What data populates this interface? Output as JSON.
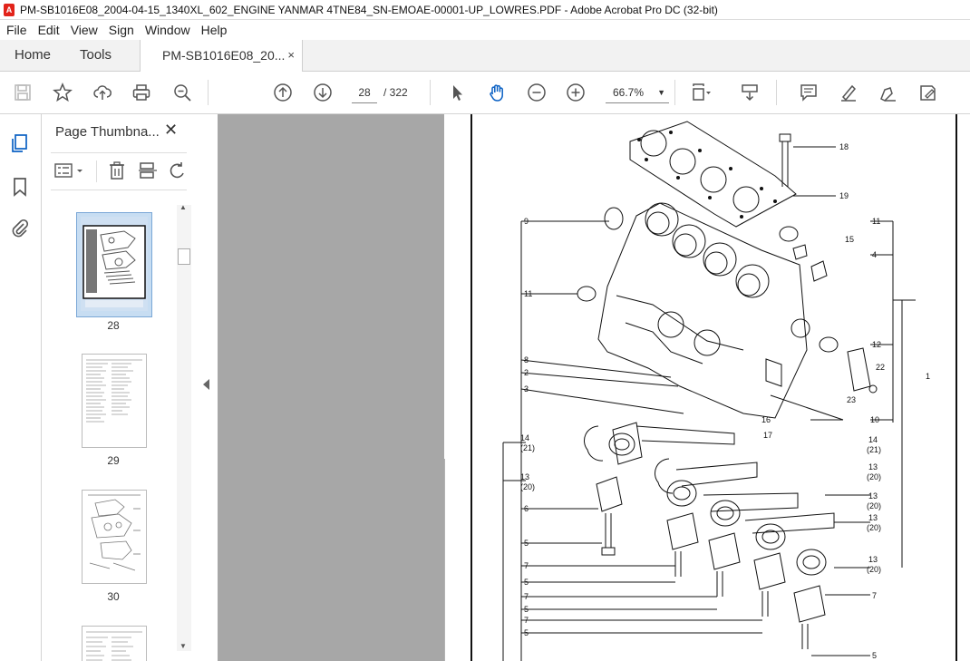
{
  "titlebar": {
    "title": "PM-SB1016E08_2004-04-15_1340XL_602_ENGINE YANMAR 4TNE84_SN-EMOAE-00001-UP_LOWRES.PDF - Adobe Acrobat Pro DC (32-bit)"
  },
  "menu": [
    "File",
    "Edit",
    "View",
    "Sign",
    "Window",
    "Help"
  ],
  "tabs": {
    "home": "Home",
    "tools": "Tools",
    "doc": "PM-SB1016E08_20...",
    "close": "×"
  },
  "toolbar": {
    "page_current": "28",
    "page_total": "/ 322",
    "zoom": "66.7%"
  },
  "panel": {
    "title": "Page Thumbna...",
    "close": "✕"
  },
  "thumbnails": [
    "28",
    "29",
    "30"
  ],
  "diagram_labels": [
    "18",
    "19",
    "9",
    "11",
    "15",
    "4",
    "11",
    "12",
    "1",
    "22",
    "23",
    "8",
    "2",
    "3",
    "10",
    "16",
    "17",
    "14",
    "(21)",
    "13",
    "(20)",
    "14",
    "(21)",
    "13",
    "(20)",
    "6",
    "13",
    "(20)",
    "13",
    "(20)",
    "5",
    "13",
    "(20)",
    "7",
    "5",
    "7",
    "5",
    "7",
    "5",
    "7",
    "5"
  ],
  "colors": {
    "accent": "#0b61c4",
    "canvas": "#a7a7a7",
    "selected_thumb": "#c7ddf2"
  }
}
